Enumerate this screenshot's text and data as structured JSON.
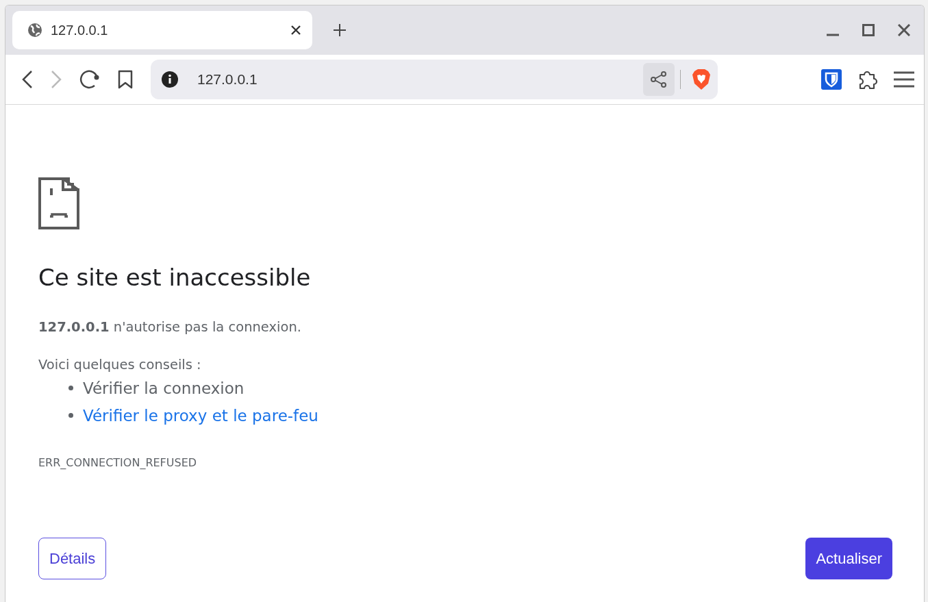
{
  "tabs": [
    {
      "title": "127.0.0.1",
      "selected": true
    }
  ],
  "address_bar": {
    "url": "127.0.0.1"
  },
  "nav": {
    "back_disabled": false,
    "forward_disabled": true
  },
  "error_page": {
    "heading": "Ce site est inaccessible",
    "message": "**127.0.0.1** n'autorise pas la connexion.",
    "suggestions_intro": "Voici quelques conseils :",
    "suggestions": [
      {
        "text": "Vérifier la connexion",
        "kind": "text"
      },
      {
        "text": "Vérifier le proxy et le pare-feu",
        "kind": "link"
      }
    ],
    "error_code": "ERR_CONNECTION_REFUSED",
    "details_button": "Détails",
    "reload_button": "Actualiser"
  }
}
